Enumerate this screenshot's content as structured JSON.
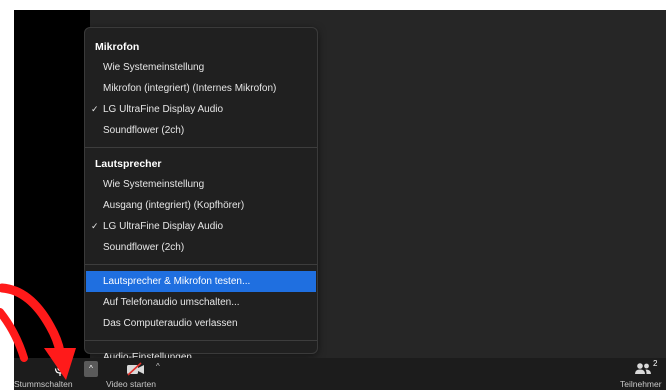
{
  "menu": {
    "microphone": {
      "title": "Mikrofon",
      "items": [
        {
          "label": "Wie Systemeinstellung",
          "checked": false
        },
        {
          "label": "Mikrofon (integriert) (Internes Mikrofon)",
          "checked": false
        },
        {
          "label": "LG UltraFine Display Audio",
          "checked": true
        },
        {
          "label": "Soundflower (2ch)",
          "checked": false
        }
      ]
    },
    "speaker": {
      "title": "Lautsprecher",
      "items": [
        {
          "label": "Wie Systemeinstellung",
          "checked": false
        },
        {
          "label": "Ausgang (integriert) (Kopfhörer)",
          "checked": false
        },
        {
          "label": "LG UltraFine Display Audio",
          "checked": true
        },
        {
          "label": "Soundflower (2ch)",
          "checked": false
        }
      ]
    },
    "actions": [
      {
        "label": "Lautsprecher & Mikrofon testen...",
        "highlighted": true
      },
      {
        "label": "Auf Telefonaudio umschalten...",
        "highlighted": false
      },
      {
        "label": "Das Computeraudio verlassen",
        "highlighted": false
      }
    ],
    "settings_label": "Audio-Einstellungen...",
    "check_glyph": "✓"
  },
  "toolbar": {
    "mute_label": "Stummschalten",
    "mute_caret": "^",
    "video_label": "Video starten",
    "video_caret": "^",
    "participants_label": "Teilnehmer",
    "participants_count": "2"
  },
  "colors": {
    "highlight": "#1f6fe0",
    "annotation_red": "#ff1a1a",
    "video_off_slash": "#e0302a"
  },
  "icons": {
    "mic": "microphone-icon",
    "video": "video-off-icon",
    "participants": "people-icon"
  }
}
